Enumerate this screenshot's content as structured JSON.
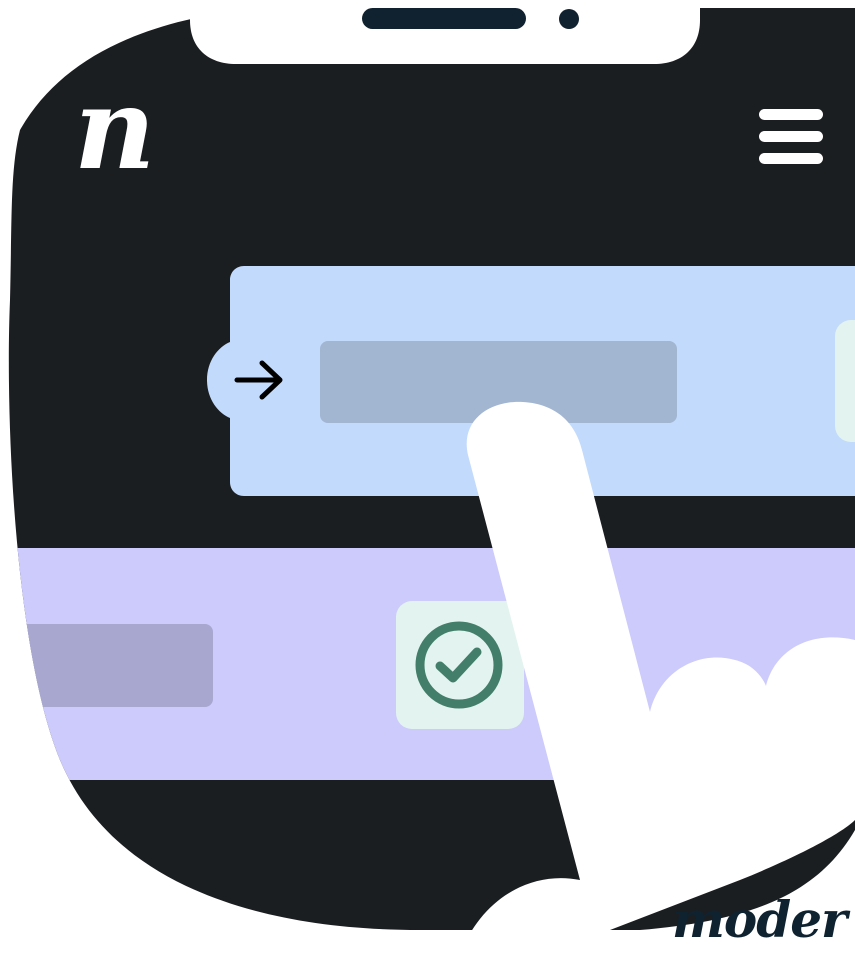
{
  "brand": {
    "logo_fragment": "n",
    "wordmark": "moder"
  },
  "colors": {
    "phone_bg": "#1b1e21",
    "notch": "#ffffff",
    "speaker": "#10222f",
    "card_primary": "#c2dafc",
    "card_primary_field": "#a2b5d1",
    "card_secondary": "#cccbfb",
    "card_secondary_field": "#a8a7cf",
    "check_tile": "#e3f3ef",
    "check_green": "#427e6a",
    "hand": "#ffffff",
    "wordmark": "#0f2230"
  },
  "icons": {
    "menu": "hamburger-menu-icon",
    "arrow": "arrow-right-icon",
    "check": "check-circle-icon",
    "hand": "pointing-hand-icon"
  }
}
